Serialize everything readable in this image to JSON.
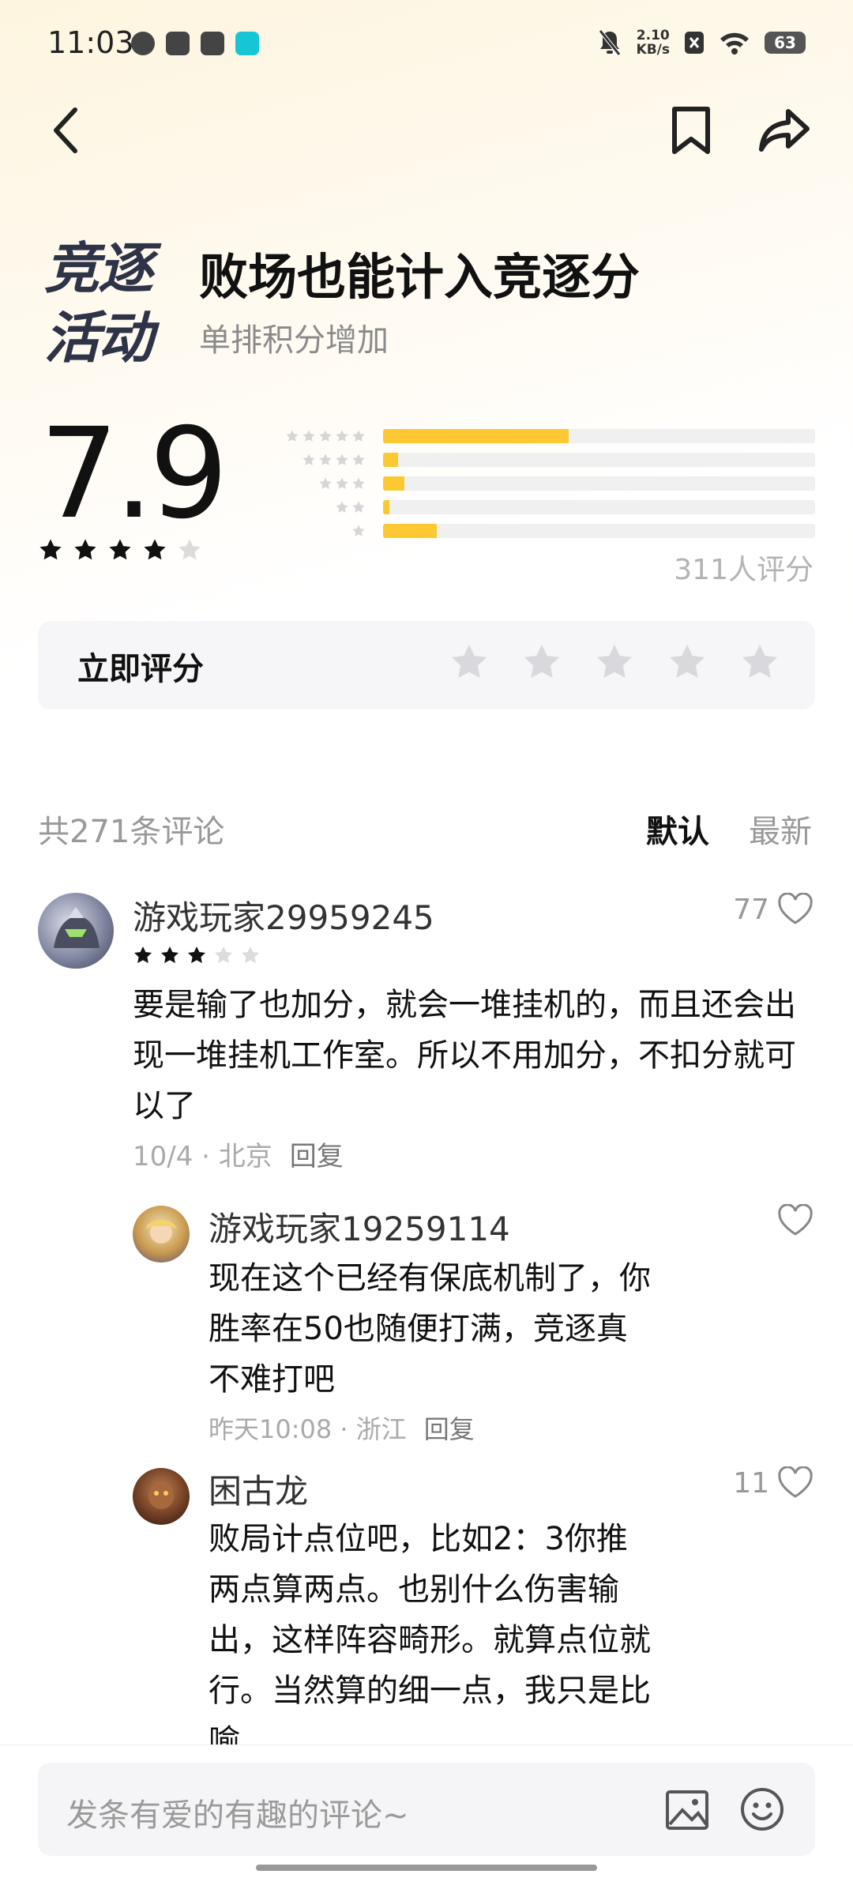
{
  "status_bar": {
    "time": "11:03",
    "net_speed_value": "2.10",
    "net_speed_unit": "KB/s",
    "battery": "63"
  },
  "header": {
    "logo_line1": "竞逐",
    "logo_line2": "活动",
    "title": "败场也能计入竞逐分",
    "subtitle": "单排积分增加"
  },
  "rating": {
    "score": "7.9",
    "score_stars_filled": 4,
    "distribution": [
      {
        "stars": 5,
        "fraction": 0.43
      },
      {
        "stars": 4,
        "fraction": 0.035
      },
      {
        "stars": 3,
        "fraction": 0.05
      },
      {
        "stars": 2,
        "fraction": 0.015
      },
      {
        "stars": 1,
        "fraction": 0.125
      }
    ],
    "raters_text": "311人评分",
    "rate_now_label": "立即评分",
    "bar_color": "#fcc933"
  },
  "comments_header": {
    "count_text": "共271条评论",
    "sort_default": "默认",
    "sort_latest": "最新"
  },
  "comments": [
    {
      "username": "游戏玩家29959245",
      "stars": 3,
      "likes": "77",
      "text": "要是输了也加分，就会一堆挂机的，而且还会出现一堆挂机工作室。所以不用加分，不扣分就可以了",
      "date_location": "10/4 · 北京",
      "reply_label": "回复"
    },
    {
      "username": "游戏玩家19259114",
      "likes": "",
      "text": "现在这个已经有保底机制了，你胜率在50也随便打满，竞逐真不难打吧",
      "date_location": "昨天10:08 · 浙江",
      "reply_label": "回复"
    },
    {
      "username": "困古龙",
      "likes": "11",
      "text": "败局计点位吧，比如2：3你推两点算两点。也别什么伤害输出，这样阵容畸形。就算点位就行。当然算的细一点，我只是比喻"
    }
  ],
  "composer": {
    "placeholder": "发条有爱的有趣的评论~"
  }
}
